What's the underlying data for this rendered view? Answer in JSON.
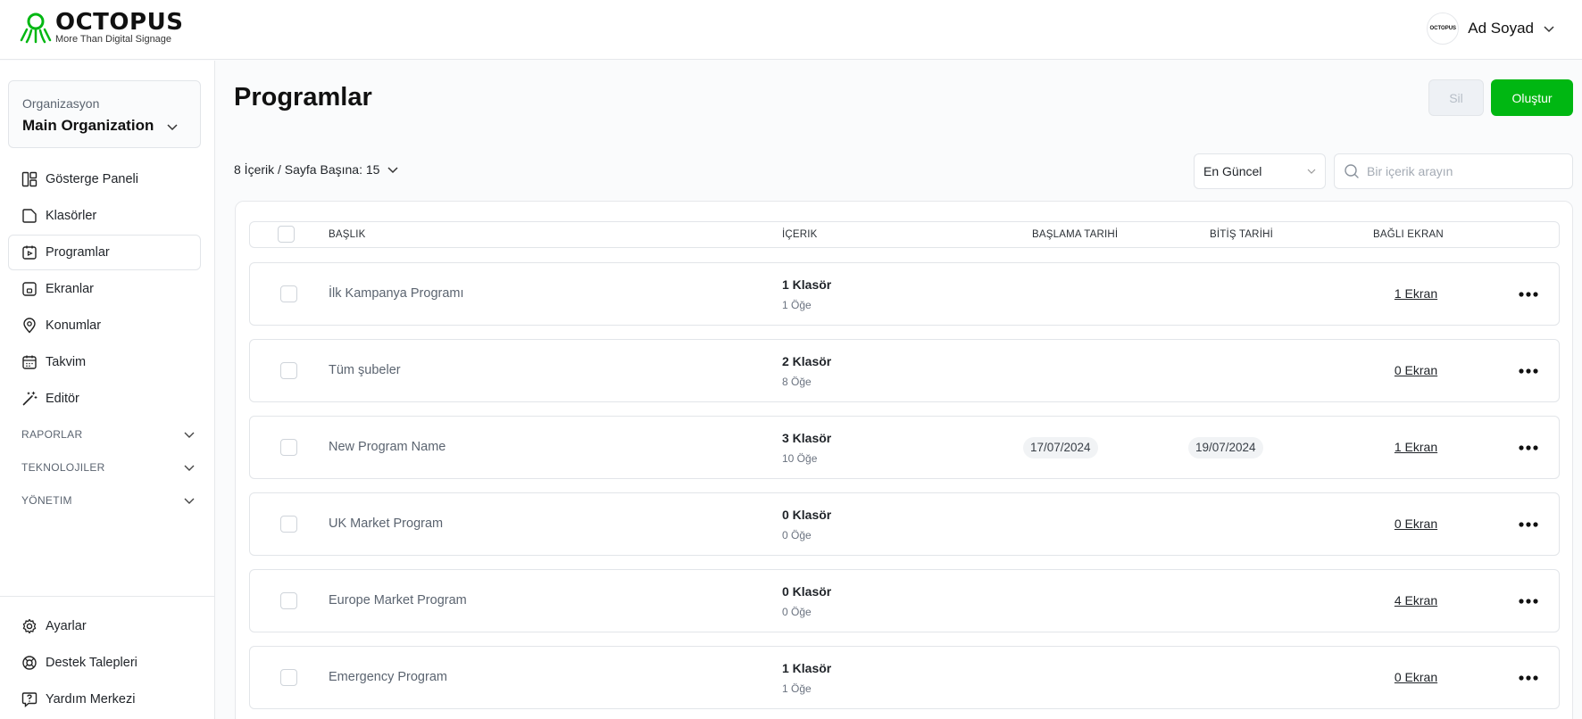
{
  "brand": {
    "name": "OCTOPUS",
    "tagline": "More Than Digital Signage",
    "accent": "#00b712",
    "avatar_text": "OCTOPUS"
  },
  "user": {
    "name": "Ad Soyad"
  },
  "organization": {
    "label": "Organizasyon",
    "value": "Main Organization"
  },
  "nav": {
    "items": [
      {
        "label": "Gösterge Paneli",
        "icon": "dashboard-icon"
      },
      {
        "label": "Klasörler",
        "icon": "folder-icon"
      },
      {
        "label": "Programlar",
        "icon": "program-icon",
        "active": true
      },
      {
        "label": "Ekranlar",
        "icon": "screen-icon"
      },
      {
        "label": "Konumlar",
        "icon": "location-icon"
      },
      {
        "label": "Takvim",
        "icon": "calendar-icon"
      },
      {
        "label": "Editör",
        "icon": "editor-wand-icon"
      }
    ],
    "sections": [
      "RAPORLAR",
      "TEKNOLOJILER",
      "YÖNETIM"
    ],
    "bottom": [
      {
        "label": "Ayarlar",
        "icon": "gear-icon"
      },
      {
        "label": "Destek Talepleri",
        "icon": "lifebuoy-icon"
      },
      {
        "label": "Yardım Merkezi",
        "icon": "help-icon"
      }
    ]
  },
  "page": {
    "title": "Programlar",
    "delete_label": "Sil",
    "create_label": "Oluştur",
    "count_text": "8 İçerik / Sayfa Başına: 15",
    "sort_value": "En Güncel",
    "search_placeholder": "Bir içerik arayın"
  },
  "table": {
    "columns": [
      "BAŞLIK",
      "İÇERIK",
      "BAŞLAMA TARIHİ",
      "BİTİŞ TARİHİ",
      "BAĞLI EKRAN"
    ],
    "rows": [
      {
        "title": "İlk Kampanya Programı",
        "folders": "1 Klasör",
        "items": "1 Öğe",
        "start": "",
        "end": "",
        "screens": "1 Ekran"
      },
      {
        "title": "Tüm şubeler",
        "folders": "2 Klasör",
        "items": "8 Öğe",
        "start": "",
        "end": "",
        "screens": "0 Ekran"
      },
      {
        "title": "New Program Name",
        "folders": "3 Klasör",
        "items": "10 Öğe",
        "start": "17/07/2024",
        "end": "19/07/2024",
        "screens": "1 Ekran"
      },
      {
        "title": "UK Market Program",
        "folders": "0 Klasör",
        "items": "0 Öğe",
        "start": "",
        "end": "",
        "screens": "0 Ekran"
      },
      {
        "title": "Europe Market Program",
        "folders": "0 Klasör",
        "items": "0 Öğe",
        "start": "",
        "end": "",
        "screens": "4 Ekran"
      },
      {
        "title": "Emergency Program",
        "folders": "1 Klasör",
        "items": "1 Öğe",
        "start": "",
        "end": "",
        "screens": "0 Ekran"
      }
    ]
  }
}
